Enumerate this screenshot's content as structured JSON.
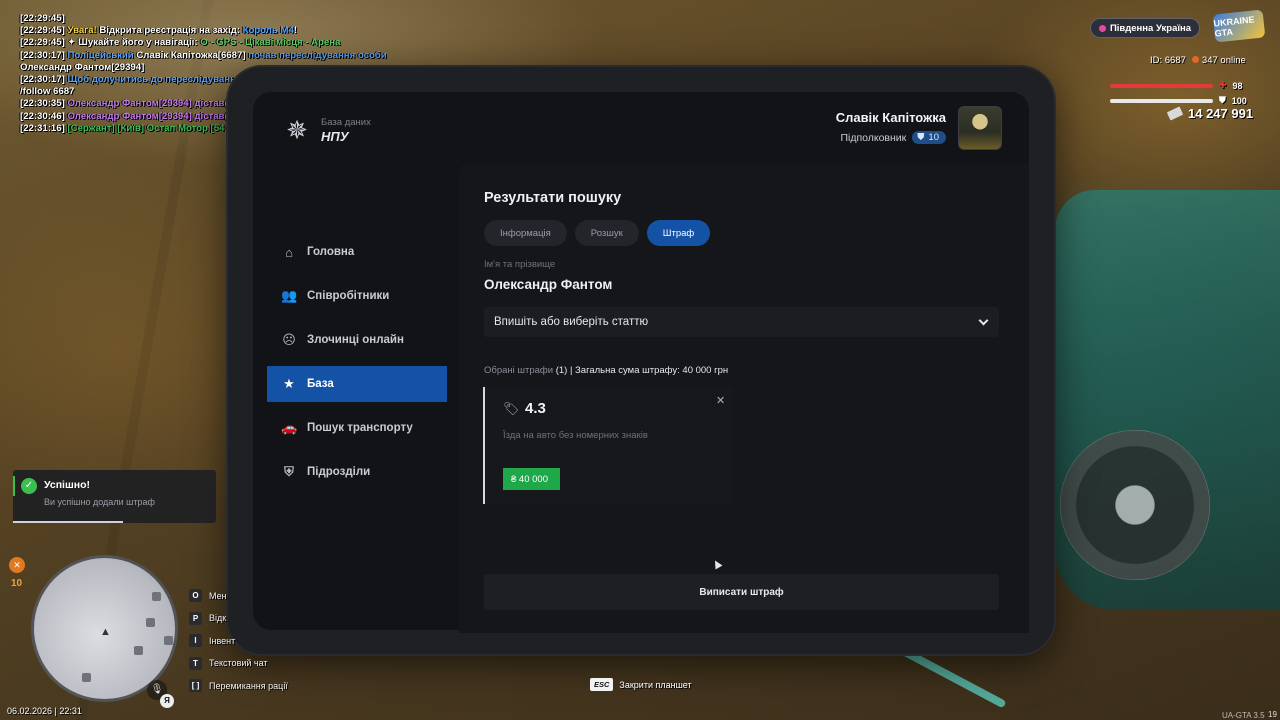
{
  "chat": [
    {
      "parts": [
        {
          "t": "[22:29:45]",
          "c": "c-wht"
        }
      ]
    },
    {
      "parts": [
        {
          "t": "[22:29:45] ",
          "c": "c-wht"
        },
        {
          "t": "Увага! ",
          "c": "c-yel"
        },
        {
          "t": "Відкрита реєстрація на захід: ",
          "c": "c-wht"
        },
        {
          "t": "Король М4",
          "c": "c-blue"
        },
        {
          "t": "!",
          "c": "c-wht"
        }
      ]
    },
    {
      "parts": [
        {
          "t": "[22:29:45] ",
          "c": "c-wht"
        },
        {
          "t": "✦ Шукайте його у навігації: ",
          "c": "c-wht"
        },
        {
          "t": "O - GPS - Цікаві місця - Арена",
          "c": "c-grn2"
        }
      ]
    },
    {
      "parts": [
        {
          "t": "[22:30:17] ",
          "c": "c-wht"
        },
        {
          "t": "Поліцейський ",
          "c": "c-blue"
        },
        {
          "t": "Славік Капітожка[6687] ",
          "c": "c-wht"
        },
        {
          "t": "почав переслідування особи",
          "c": "c-blue"
        }
      ]
    },
    {
      "parts": [
        {
          "t": " Олександр Фантом[29394]",
          "c": "c-wht"
        }
      ]
    },
    {
      "parts": [
        {
          "t": "[22:30:17] ",
          "c": "c-wht"
        },
        {
          "t": "Щоб долучитись до переслідування, використовуйте команду:",
          "c": "c-blue"
        }
      ]
    },
    {
      "parts": [
        {
          "t": "/follow 6687",
          "c": "c-wht"
        }
      ]
    },
    {
      "parts": [
        {
          "t": "[22:30:35] ",
          "c": "c-wht"
        },
        {
          "t": "Олександр Фантом[29394] дістав(ла) паспорт",
          "c": "c-pur"
        }
      ]
    },
    {
      "parts": [
        {
          "t": "[22:30:46] ",
          "c": "c-wht"
        },
        {
          "t": "Олександр Фантом[29394] дістав(ла) тех.паспорт",
          "c": "c-pur"
        }
      ]
    },
    {
      "parts": [
        {
          "t": "[22:31:16] ",
          "c": "c-wht"
        },
        {
          "t": "[Сержант] [Київ] Остап Мотор [54136]: ",
          "c": "c-green"
        },
        {
          "t": "хтось бажає в патрулю",
          "c": "c-wht"
        }
      ]
    }
  ],
  "hud": {
    "region": "Південна Україна",
    "server_logo": "UKRAINE GTA",
    "id_label": "ID: 6687",
    "online": "347 online",
    "health": "98",
    "health_color": "#e5393b",
    "armor": "100",
    "armor_color": "#e8e8e8",
    "money": "14 247 991"
  },
  "tablet": {
    "brand_sub": "База даних",
    "brand_main": "НПУ",
    "user_name": "Славік Капітожка",
    "user_rank": "Підполковник",
    "user_level": "10",
    "nav": [
      {
        "label": "Головна",
        "icon": "home-icon",
        "glyph": "⌂",
        "active": false
      },
      {
        "label": "Співробітники",
        "icon": "people-icon",
        "glyph": "👥",
        "active": false
      },
      {
        "label": "Злочинці онлайн",
        "icon": "criminal-icon",
        "glyph": "☹",
        "active": false
      },
      {
        "label": "База",
        "icon": "star-icon",
        "glyph": "★",
        "active": true
      },
      {
        "label": "Пошук транспорту",
        "icon": "car-icon",
        "glyph": "🚗",
        "active": false
      },
      {
        "label": "Підрозділи",
        "icon": "shield-icon",
        "glyph": "⛨",
        "active": false
      }
    ],
    "results_title": "Результати пошуку",
    "tabs": [
      {
        "label": "Інформація",
        "active": false
      },
      {
        "label": "Розшук",
        "active": false
      },
      {
        "label": "Штраф",
        "active": true
      }
    ],
    "name_label": "Ім'я та прізвище",
    "name_value": "Олександр Фантом",
    "select_placeholder": "Впишіть або виберіть статтю",
    "summary_prefix": "Обрані штрафи",
    "summary_rest": " (1) | Загальна сума штрафу: 40 000 грн",
    "fine": {
      "code": "4.3",
      "description": "Їзда на авто без номерних знаків",
      "amount": "₴ 40 000"
    },
    "submit_label": "Виписати штраф"
  },
  "toast": {
    "title": "Успішно!",
    "text": "Ви успішно додали штраф",
    "progress": 0.54
  },
  "hunger_value": "10",
  "keys": [
    {
      "key": "O",
      "label": "Мен"
    },
    {
      "key": "P",
      "label": "Відк"
    },
    {
      "key": "I",
      "label": "Інвент"
    },
    {
      "key": "T",
      "label": "Текстовий чат"
    },
    {
      "key": "[  ]",
      "label": "Перемикання рації"
    }
  ],
  "lang": "Я",
  "datetime": "06.02.2026 | 22:31",
  "esc_key": "ESC",
  "esc_label": "Закрити планшет",
  "version": "UA-GTA 3.5",
  "page_num": "19"
}
